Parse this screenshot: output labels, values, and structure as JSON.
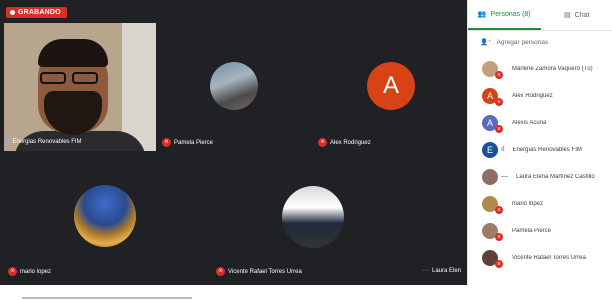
{
  "recording": {
    "label": "GRABANDO"
  },
  "participants_tiles": [
    {
      "name": "Energias Renovables FIM"
    },
    {
      "name": "Pamela Pierce"
    },
    {
      "name": "Alex Rodriguez",
      "letter": "A"
    },
    {
      "name": "mario lopez"
    },
    {
      "name": "Vicente Rafael Torres Urrea"
    },
    {
      "name": "Laura Elen"
    }
  ],
  "panel": {
    "tab_people": "Personas (8)",
    "tab_chat": "Chat",
    "add_people": "Agregar personas",
    "people": [
      {
        "name": "Marlene Zamora Vaquero (Tú)",
        "letter": "",
        "color": "#c7a07a"
      },
      {
        "name": "Alex Rodriguez",
        "letter": "A",
        "color": "#d84315"
      },
      {
        "name": "Alexis Acuña",
        "letter": "A",
        "color": "#5c6bc0"
      },
      {
        "name": "Energías Renovables FIM",
        "letter": "E",
        "color": "#1a4fa0"
      },
      {
        "name": "Laura Elena Martínez Castillo",
        "letter": "",
        "color": "#8d6e63"
      },
      {
        "name": "mario lópez",
        "letter": "",
        "color": "#b08a50"
      },
      {
        "name": "Pamela Pierce",
        "letter": "",
        "color": "#9e7b6a"
      },
      {
        "name": "Vicente Rafael Torres Urrea",
        "letter": "",
        "color": "#5d4037"
      }
    ]
  },
  "icons": {
    "mic_off": "mic-off-icon",
    "people": "people-icon",
    "chat": "chat-icon",
    "add_person": "add-person-icon"
  }
}
